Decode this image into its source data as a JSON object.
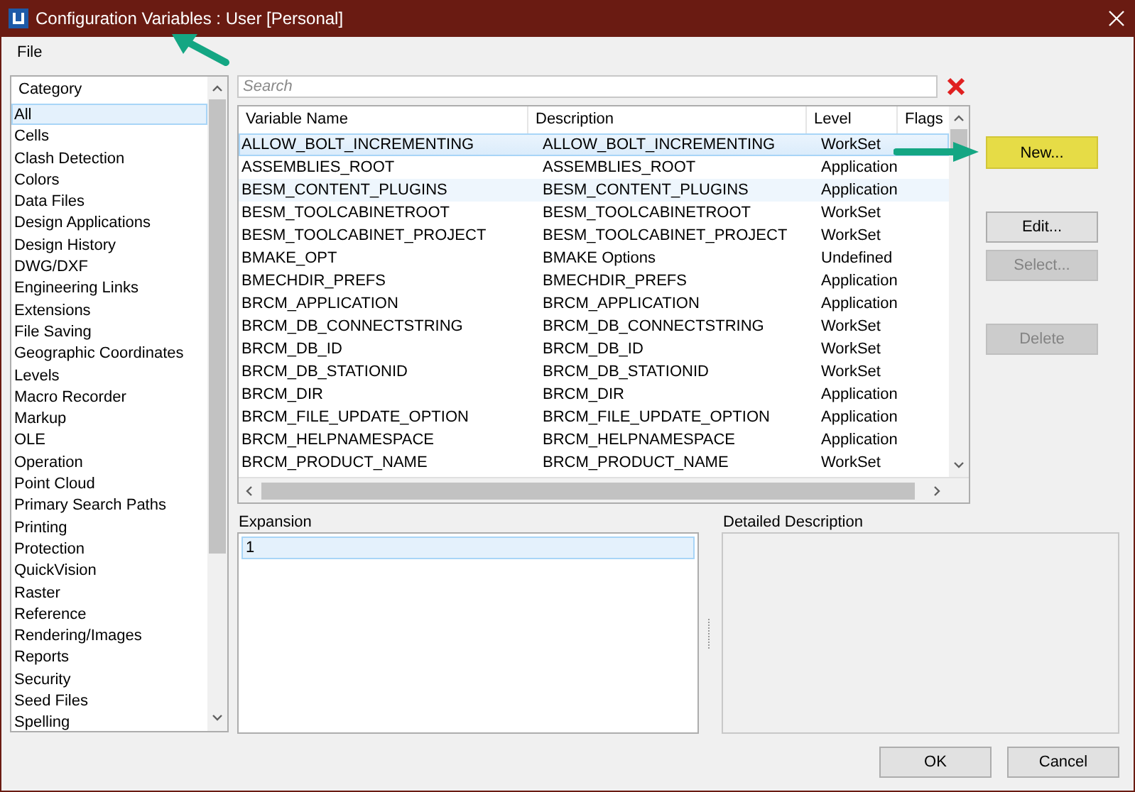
{
  "window": {
    "title": "Configuration Variables : User [Personal]",
    "pointed": true
  },
  "menu": [
    {
      "label": "File"
    }
  ],
  "category": {
    "header": "Category",
    "items": [
      {
        "label": "All",
        "selected": true
      },
      {
        "label": "Cells",
        "selected": false
      },
      {
        "label": "Clash Detection",
        "selected": false
      },
      {
        "label": "Colors",
        "selected": false
      },
      {
        "label": "Data Files",
        "selected": false
      },
      {
        "label": "Design Applications",
        "selected": false
      },
      {
        "label": "Design History",
        "selected": false
      },
      {
        "label": "DWG/DXF",
        "selected": false
      },
      {
        "label": "Engineering Links",
        "selected": false
      },
      {
        "label": "Extensions",
        "selected": false
      },
      {
        "label": "File Saving",
        "selected": false
      },
      {
        "label": "Geographic Coordinates",
        "selected": false
      },
      {
        "label": "Levels",
        "selected": false
      },
      {
        "label": "Macro Recorder",
        "selected": false
      },
      {
        "label": "Markup",
        "selected": false
      },
      {
        "label": "OLE",
        "selected": false
      },
      {
        "label": "Operation",
        "selected": false
      },
      {
        "label": "Point Cloud",
        "selected": false
      },
      {
        "label": "Primary Search Paths",
        "selected": false
      },
      {
        "label": "Printing",
        "selected": false
      },
      {
        "label": "Protection",
        "selected": false
      },
      {
        "label": "QuickVision",
        "selected": false
      },
      {
        "label": "Raster",
        "selected": false
      },
      {
        "label": "Reference",
        "selected": false
      },
      {
        "label": "Rendering/Images",
        "selected": false
      },
      {
        "label": "Reports",
        "selected": false
      },
      {
        "label": "Security",
        "selected": false
      },
      {
        "label": "Seed Files",
        "selected": false
      },
      {
        "label": "Spelling",
        "selected": false
      }
    ]
  },
  "search": {
    "placeholder": "Search"
  },
  "table": {
    "columns": [
      "Variable Name",
      "Description",
      "Level",
      "Flags"
    ],
    "rows": [
      {
        "cells": [
          "ALLOW_BOLT_INCREMENTING",
          "ALLOW_BOLT_INCREMENTING",
          "WorkSet"
        ],
        "selected": true,
        "hovered": false
      },
      {
        "cells": [
          "ASSEMBLIES_ROOT",
          "ASSEMBLIES_ROOT",
          "Application"
        ],
        "selected": false,
        "hovered": false
      },
      {
        "cells": [
          "BESM_CONTENT_PLUGINS",
          "BESM_CONTENT_PLUGINS",
          "Application"
        ],
        "selected": false,
        "hovered": true
      },
      {
        "cells": [
          "BESM_TOOLCABINETROOT",
          "BESM_TOOLCABINETROOT",
          "WorkSet"
        ],
        "selected": false,
        "hovered": false
      },
      {
        "cells": [
          "BESM_TOOLCABINET_PROJECT",
          "BESM_TOOLCABINET_PROJECT",
          "WorkSet"
        ],
        "selected": false,
        "hovered": false
      },
      {
        "cells": [
          "BMAKE_OPT",
          "BMAKE Options",
          "Undefined"
        ],
        "selected": false,
        "hovered": false
      },
      {
        "cells": [
          "BMECHDIR_PREFS",
          "BMECHDIR_PREFS",
          "Application"
        ],
        "selected": false,
        "hovered": false
      },
      {
        "cells": [
          "BRCM_APPLICATION",
          "BRCM_APPLICATION",
          "Application"
        ],
        "selected": false,
        "hovered": false
      },
      {
        "cells": [
          "BRCM_DB_CONNECTSTRING",
          "BRCM_DB_CONNECTSTRING",
          "WorkSet"
        ],
        "selected": false,
        "hovered": false
      },
      {
        "cells": [
          "BRCM_DB_ID",
          "BRCM_DB_ID",
          "WorkSet"
        ],
        "selected": false,
        "hovered": false
      },
      {
        "cells": [
          "BRCM_DB_STATIONID",
          "BRCM_DB_STATIONID",
          "WorkSet"
        ],
        "selected": false,
        "hovered": false
      },
      {
        "cells": [
          "BRCM_DIR",
          "BRCM_DIR",
          "Application"
        ],
        "selected": false,
        "hovered": false
      },
      {
        "cells": [
          "BRCM_FILE_UPDATE_OPTION",
          "BRCM_FILE_UPDATE_OPTION",
          "Application"
        ],
        "selected": false,
        "hovered": false
      },
      {
        "cells": [
          "BRCM_HELPNAMESPACE",
          "BRCM_HELPNAMESPACE",
          "Application"
        ],
        "selected": false,
        "hovered": false
      },
      {
        "cells": [
          "BRCM_PRODUCT_NAME",
          "BRCM_PRODUCT_NAME",
          "WorkSet"
        ],
        "selected": false,
        "hovered": false
      }
    ]
  },
  "side_buttons": [
    [
      {
        "label": "New...",
        "disabled": false,
        "highlighted": true,
        "pointed": true
      }
    ],
    [
      {
        "label": "Edit...",
        "disabled": false,
        "highlighted": false,
        "pointed": false
      },
      {
        "label": "Select...",
        "disabled": true,
        "highlighted": false,
        "pointed": false
      }
    ],
    [
      {
        "label": "Delete",
        "disabled": true,
        "highlighted": false,
        "pointed": false
      }
    ]
  ],
  "expansion": {
    "label": "Expansion",
    "items": [
      {
        "label": "1",
        "selected": true
      }
    ]
  },
  "detailed_description": {
    "label": "Detailed Description"
  },
  "footer_buttons": [
    "OK",
    "Cancel"
  ]
}
